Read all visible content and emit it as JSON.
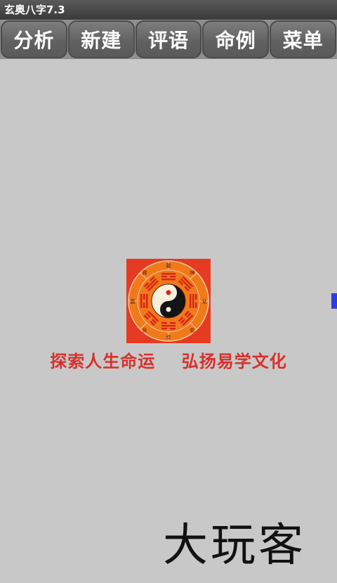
{
  "app": {
    "title": "玄奥八字7.3"
  },
  "toolbar": {
    "buttons": [
      {
        "label": "分析"
      },
      {
        "label": "新建"
      },
      {
        "label": "评语"
      },
      {
        "label": "命例"
      },
      {
        "label": "菜单"
      }
    ]
  },
  "logo": {
    "icon": "bagua-yin-yang-icon",
    "trigrams": [
      "離",
      "坤",
      "兌",
      "乾",
      "坎",
      "艮",
      "震",
      "巽"
    ]
  },
  "slogan": "探索人生命运    弘扬易学文化",
  "watermark": "大玩客",
  "colors": {
    "accent_red": "#d9302b",
    "logo_orange": "#f07a1a",
    "handle_blue": "#2e3de0"
  }
}
